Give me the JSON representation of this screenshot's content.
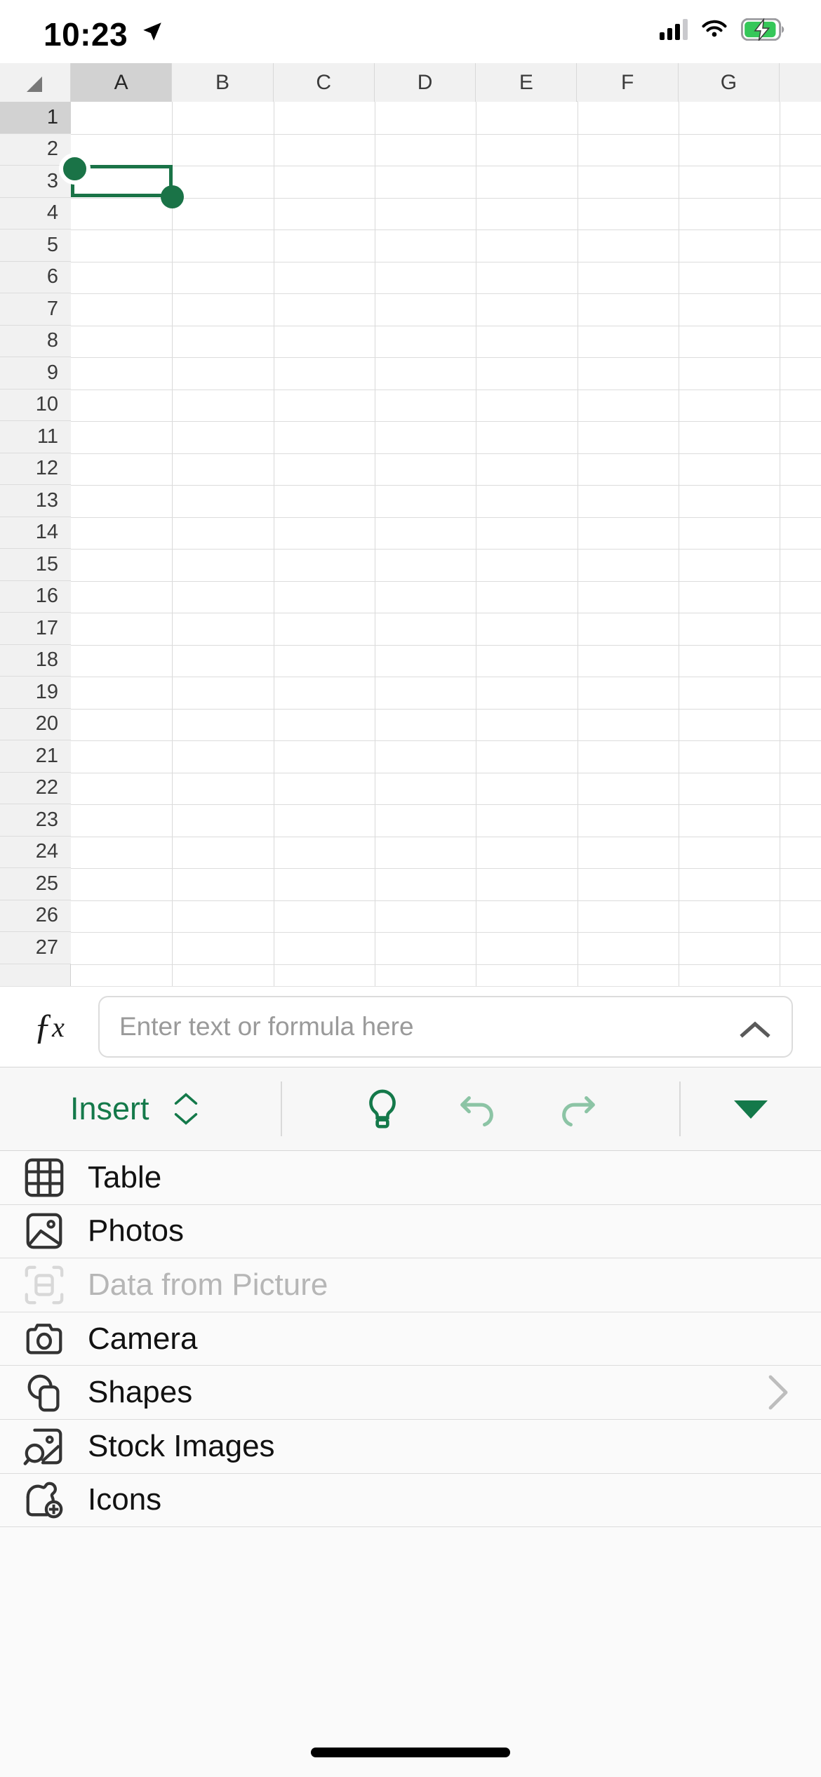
{
  "status_bar": {
    "time": "10:23",
    "location_icon": "location-arrow-icon",
    "signal_icon": "cellular-signal-icon",
    "wifi_icon": "wifi-icon",
    "battery_icon": "battery-charging-icon",
    "battery_color": "#35c759"
  },
  "spreadsheet": {
    "select_all_icon": "select-all-corner-icon",
    "columns": [
      "A",
      "B",
      "C",
      "D",
      "E",
      "F",
      "G"
    ],
    "rows": [
      "1",
      "2",
      "3",
      "4",
      "5",
      "6",
      "7",
      "8",
      "9",
      "10",
      "11",
      "12",
      "13",
      "14",
      "15",
      "16",
      "17",
      "18",
      "19",
      "20",
      "21",
      "22",
      "23",
      "24",
      "25",
      "26",
      "27"
    ],
    "selected_cell": "A1",
    "selected_column": "A",
    "selected_row": "1",
    "selection_color": "#1a7347",
    "handle_top_left": "selection-handle-top-left",
    "handle_bottom_right": "selection-handle-bottom-right"
  },
  "formula_bar": {
    "fx_icon": "fx-function-icon",
    "value": "",
    "placeholder": "Enter text or formula here",
    "expand_icon": "chevron-up-icon"
  },
  "toolbar": {
    "tab_label": "Insert",
    "tab_stepper_up_icon": "chevron-up-icon",
    "tab_stepper_down_icon": "chevron-down-icon",
    "tell_me_icon": "lightbulb-icon",
    "undo_icon": "undo-icon",
    "redo_icon": "redo-icon",
    "collapse_icon": "triangle-down-icon",
    "accent_color": "#14794a",
    "disabled_color": "#8cc4a5"
  },
  "insert_menu": {
    "items": [
      {
        "label": "Table",
        "icon": "table-grid-icon",
        "disabled": false,
        "chevron": false
      },
      {
        "label": "Photos",
        "icon": "photo-image-icon",
        "disabled": false,
        "chevron": false
      },
      {
        "label": "Data from Picture",
        "icon": "scan-data-icon",
        "disabled": true,
        "chevron": false
      },
      {
        "label": "Camera",
        "icon": "camera-icon",
        "disabled": false,
        "chevron": false
      },
      {
        "label": "Shapes",
        "icon": "shapes-icon",
        "disabled": false,
        "chevron": true
      },
      {
        "label": "Stock Images",
        "icon": "stock-images-icon",
        "disabled": false,
        "chevron": false
      },
      {
        "label": "Icons",
        "icon": "icons-sticker-icon",
        "disabled": false,
        "chevron": false
      }
    ]
  },
  "home_indicator": "home-indicator-bar"
}
